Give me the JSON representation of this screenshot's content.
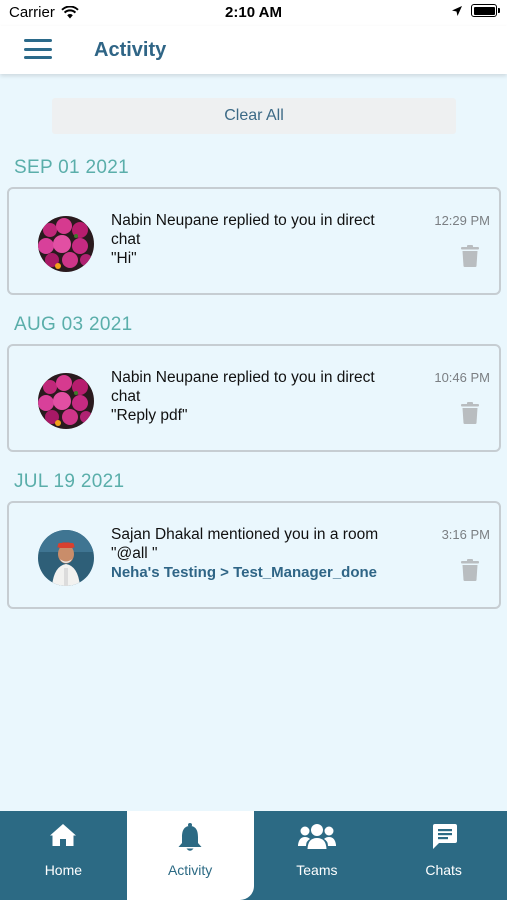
{
  "status_bar": {
    "carrier": "Carrier",
    "time": "2:10 AM"
  },
  "header": {
    "title": "Activity"
  },
  "actions": {
    "clear_all": "Clear All"
  },
  "groups": [
    {
      "date": "SEP 01 2021",
      "item": {
        "line1": "Nabin Neupane  replied to  you  in direct",
        "line2": "chat",
        "line3": "\"Hi\"",
        "time": "12:29 PM",
        "avatar": "flowers"
      }
    },
    {
      "date": "AUG 03 2021",
      "item": {
        "line1": "Nabin Neupane  replied to  you  in direct",
        "line2": "chat",
        "line3": "\"Reply pdf\"",
        "time": "10:46 PM",
        "avatar": "flowers"
      }
    },
    {
      "date": "JUL 19 2021",
      "item": {
        "line1": "Sajan  Dhakal  mentioned  you  in a room",
        "line2": "\"@all \"",
        "room": "Neha's Testing > Test_Manager_done",
        "time": "3:16 PM",
        "avatar": "person"
      }
    }
  ],
  "tabs": [
    {
      "label": "Home",
      "icon": "home-icon",
      "active": false
    },
    {
      "label": "Activity",
      "icon": "bell-icon",
      "active": true
    },
    {
      "label": "Teams",
      "icon": "users-icon",
      "active": false
    },
    {
      "label": "Chats",
      "icon": "chat-icon",
      "active": false
    }
  ],
  "colors": {
    "brand": "#2c6a84",
    "date": "#5aaeaa",
    "background": "#eaf7fd"
  }
}
